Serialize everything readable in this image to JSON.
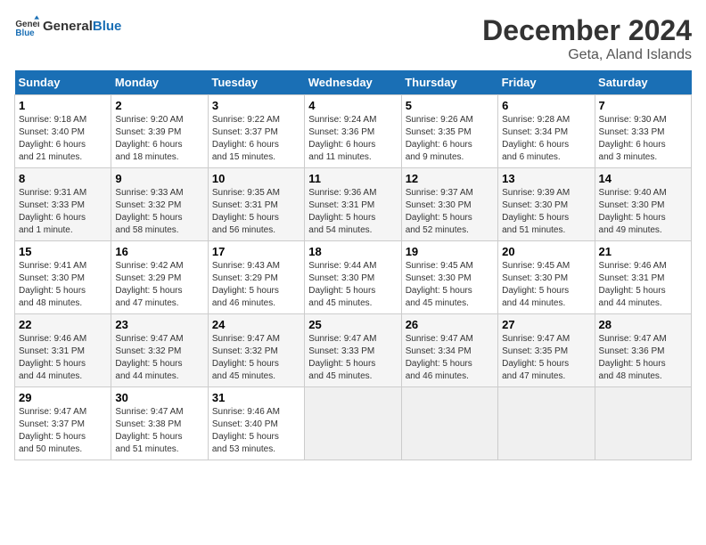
{
  "header": {
    "logo_text_general": "General",
    "logo_text_blue": "Blue",
    "month_year": "December 2024",
    "location": "Geta, Aland Islands"
  },
  "days_of_week": [
    "Sunday",
    "Monday",
    "Tuesday",
    "Wednesday",
    "Thursday",
    "Friday",
    "Saturday"
  ],
  "weeks": [
    [
      {
        "day": "1",
        "info": "Sunrise: 9:18 AM\nSunset: 3:40 PM\nDaylight: 6 hours\nand 21 minutes."
      },
      {
        "day": "2",
        "info": "Sunrise: 9:20 AM\nSunset: 3:39 PM\nDaylight: 6 hours\nand 18 minutes."
      },
      {
        "day": "3",
        "info": "Sunrise: 9:22 AM\nSunset: 3:37 PM\nDaylight: 6 hours\nand 15 minutes."
      },
      {
        "day": "4",
        "info": "Sunrise: 9:24 AM\nSunset: 3:36 PM\nDaylight: 6 hours\nand 11 minutes."
      },
      {
        "day": "5",
        "info": "Sunrise: 9:26 AM\nSunset: 3:35 PM\nDaylight: 6 hours\nand 9 minutes."
      },
      {
        "day": "6",
        "info": "Sunrise: 9:28 AM\nSunset: 3:34 PM\nDaylight: 6 hours\nand 6 minutes."
      },
      {
        "day": "7",
        "info": "Sunrise: 9:30 AM\nSunset: 3:33 PM\nDaylight: 6 hours\nand 3 minutes."
      }
    ],
    [
      {
        "day": "8",
        "info": "Sunrise: 9:31 AM\nSunset: 3:33 PM\nDaylight: 6 hours\nand 1 minute."
      },
      {
        "day": "9",
        "info": "Sunrise: 9:33 AM\nSunset: 3:32 PM\nDaylight: 5 hours\nand 58 minutes."
      },
      {
        "day": "10",
        "info": "Sunrise: 9:35 AM\nSunset: 3:31 PM\nDaylight: 5 hours\nand 56 minutes."
      },
      {
        "day": "11",
        "info": "Sunrise: 9:36 AM\nSunset: 3:31 PM\nDaylight: 5 hours\nand 54 minutes."
      },
      {
        "day": "12",
        "info": "Sunrise: 9:37 AM\nSunset: 3:30 PM\nDaylight: 5 hours\nand 52 minutes."
      },
      {
        "day": "13",
        "info": "Sunrise: 9:39 AM\nSunset: 3:30 PM\nDaylight: 5 hours\nand 51 minutes."
      },
      {
        "day": "14",
        "info": "Sunrise: 9:40 AM\nSunset: 3:30 PM\nDaylight: 5 hours\nand 49 minutes."
      }
    ],
    [
      {
        "day": "15",
        "info": "Sunrise: 9:41 AM\nSunset: 3:30 PM\nDaylight: 5 hours\nand 48 minutes."
      },
      {
        "day": "16",
        "info": "Sunrise: 9:42 AM\nSunset: 3:29 PM\nDaylight: 5 hours\nand 47 minutes."
      },
      {
        "day": "17",
        "info": "Sunrise: 9:43 AM\nSunset: 3:29 PM\nDaylight: 5 hours\nand 46 minutes."
      },
      {
        "day": "18",
        "info": "Sunrise: 9:44 AM\nSunset: 3:30 PM\nDaylight: 5 hours\nand 45 minutes."
      },
      {
        "day": "19",
        "info": "Sunrise: 9:45 AM\nSunset: 3:30 PM\nDaylight: 5 hours\nand 45 minutes."
      },
      {
        "day": "20",
        "info": "Sunrise: 9:45 AM\nSunset: 3:30 PM\nDaylight: 5 hours\nand 44 minutes."
      },
      {
        "day": "21",
        "info": "Sunrise: 9:46 AM\nSunset: 3:31 PM\nDaylight: 5 hours\nand 44 minutes."
      }
    ],
    [
      {
        "day": "22",
        "info": "Sunrise: 9:46 AM\nSunset: 3:31 PM\nDaylight: 5 hours\nand 44 minutes."
      },
      {
        "day": "23",
        "info": "Sunrise: 9:47 AM\nSunset: 3:32 PM\nDaylight: 5 hours\nand 44 minutes."
      },
      {
        "day": "24",
        "info": "Sunrise: 9:47 AM\nSunset: 3:32 PM\nDaylight: 5 hours\nand 45 minutes."
      },
      {
        "day": "25",
        "info": "Sunrise: 9:47 AM\nSunset: 3:33 PM\nDaylight: 5 hours\nand 45 minutes."
      },
      {
        "day": "26",
        "info": "Sunrise: 9:47 AM\nSunset: 3:34 PM\nDaylight: 5 hours\nand 46 minutes."
      },
      {
        "day": "27",
        "info": "Sunrise: 9:47 AM\nSunset: 3:35 PM\nDaylight: 5 hours\nand 47 minutes."
      },
      {
        "day": "28",
        "info": "Sunrise: 9:47 AM\nSunset: 3:36 PM\nDaylight: 5 hours\nand 48 minutes."
      }
    ],
    [
      {
        "day": "29",
        "info": "Sunrise: 9:47 AM\nSunset: 3:37 PM\nDaylight: 5 hours\nand 50 minutes."
      },
      {
        "day": "30",
        "info": "Sunrise: 9:47 AM\nSunset: 3:38 PM\nDaylight: 5 hours\nand 51 minutes."
      },
      {
        "day": "31",
        "info": "Sunrise: 9:46 AM\nSunset: 3:40 PM\nDaylight: 5 hours\nand 53 minutes."
      },
      {
        "day": "",
        "info": ""
      },
      {
        "day": "",
        "info": ""
      },
      {
        "day": "",
        "info": ""
      },
      {
        "day": "",
        "info": ""
      }
    ]
  ]
}
